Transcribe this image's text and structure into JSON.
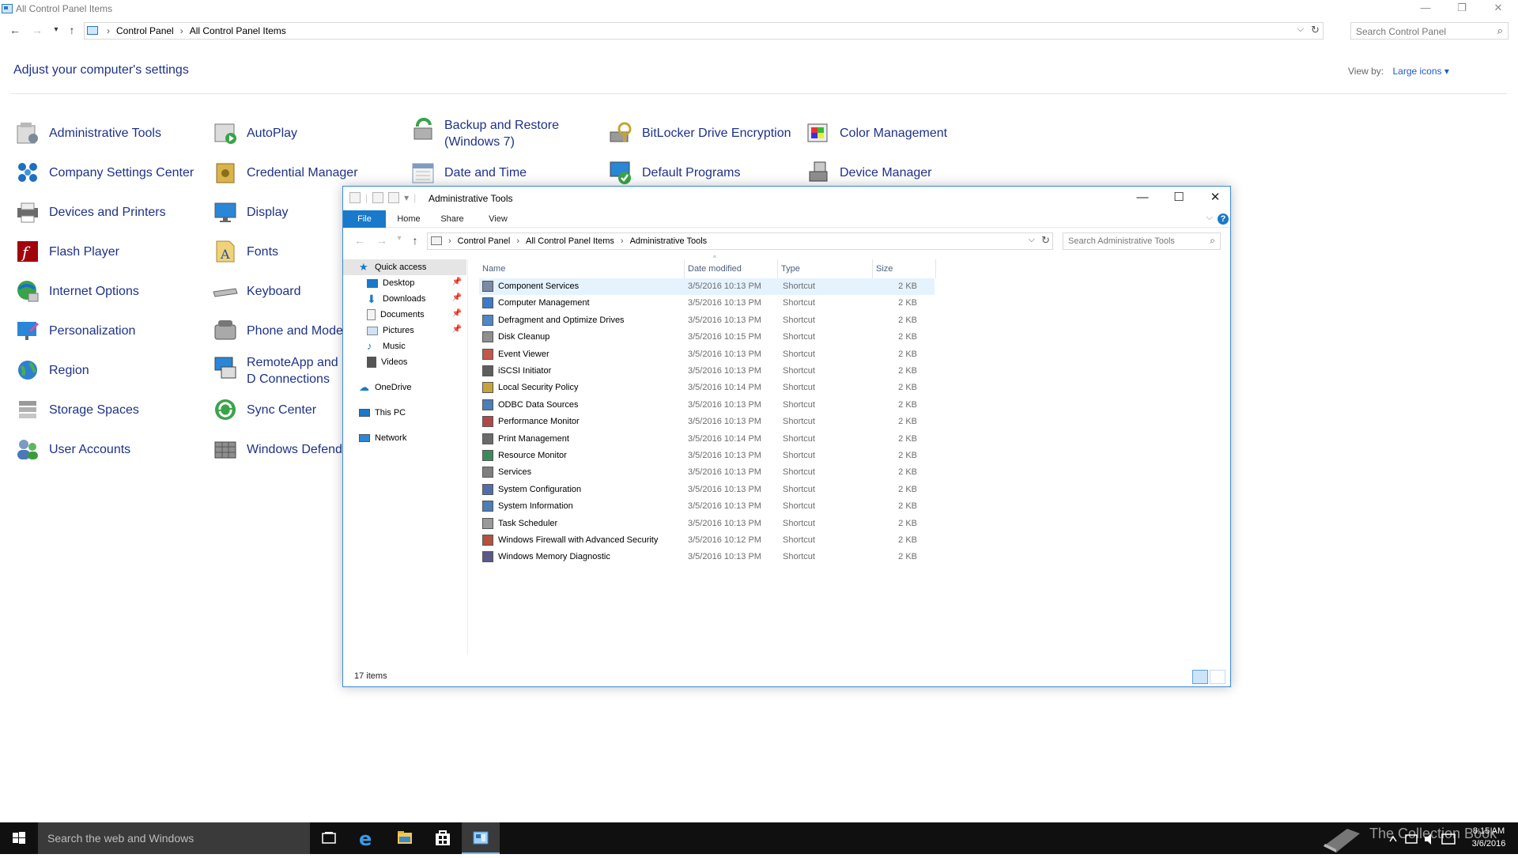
{
  "control_panel": {
    "window_title": "All Control Panel Items",
    "breadcrumb": [
      "Control Panel",
      "All Control Panel Items"
    ],
    "search_placeholder": "Search Control Panel",
    "heading": "Adjust your computer's settings",
    "view_by_label": "View by:",
    "view_by_value": "Large icons",
    "items": [
      {
        "label": "Administrative Tools",
        "icon": "admin-tools-icon"
      },
      {
        "label": "AutoPlay",
        "icon": "autoplay-icon"
      },
      {
        "label": "Backup and Restore (Windows 7)",
        "icon": "backup-icon"
      },
      {
        "label": "BitLocker Drive Encryption",
        "icon": "bitlocker-icon"
      },
      {
        "label": "Color Management",
        "icon": "color-management-icon"
      },
      {
        "label": "Company Settings Center",
        "icon": "company-settings-icon"
      },
      {
        "label": "Credential Manager",
        "icon": "credential-icon"
      },
      {
        "label": "Date and Time",
        "icon": "date-time-icon"
      },
      {
        "label": "Default Programs",
        "icon": "default-programs-icon"
      },
      {
        "label": "Device Manager",
        "icon": "device-manager-icon"
      },
      {
        "label": "Devices and Printers",
        "icon": "printer-icon"
      },
      {
        "label": "Display",
        "icon": "display-icon"
      },
      {
        "label": "Flash Player",
        "icon": "flash-icon"
      },
      {
        "label": "Fonts",
        "icon": "fonts-icon"
      },
      {
        "label": "Internet Options",
        "icon": "internet-icon"
      },
      {
        "label": "Keyboard",
        "icon": "keyboard-icon"
      },
      {
        "label": "Personalization",
        "icon": "personalization-icon"
      },
      {
        "label": "Phone and Moder",
        "icon": "phone-icon"
      },
      {
        "label": "Region",
        "icon": "globe-icon"
      },
      {
        "label": "RemoteApp and D Connections",
        "icon": "remoteapp-icon"
      },
      {
        "label": "Storage Spaces",
        "icon": "storage-icon"
      },
      {
        "label": "Sync Center",
        "icon": "sync-icon"
      },
      {
        "label": "User Accounts",
        "icon": "user-accounts-icon"
      },
      {
        "label": "Windows Defende",
        "icon": "defender-icon"
      }
    ]
  },
  "explorer": {
    "title": "Administrative Tools",
    "ribbon_tabs": [
      "File",
      "Home",
      "Share",
      "View"
    ],
    "breadcrumb": [
      "Control Panel",
      "All Control Panel Items",
      "Administrative Tools"
    ],
    "search_placeholder": "Search Administrative Tools",
    "nav": [
      {
        "label": "Quick access",
        "icon": "star-icon",
        "pinned": false
      },
      {
        "label": "Desktop",
        "icon": "desktop-icon",
        "pinned": true
      },
      {
        "label": "Downloads",
        "icon": "download-icon",
        "pinned": true
      },
      {
        "label": "Documents",
        "icon": "documents-icon",
        "pinned": true
      },
      {
        "label": "Pictures",
        "icon": "pictures-icon",
        "pinned": true
      },
      {
        "label": "Music",
        "icon": "music-icon",
        "pinned": false
      },
      {
        "label": "Videos",
        "icon": "videos-icon",
        "pinned": false
      },
      {
        "label": "OneDrive",
        "icon": "cloud-icon",
        "pinned": false
      },
      {
        "label": "This PC",
        "icon": "pc-icon",
        "pinned": false
      },
      {
        "label": "Network",
        "icon": "network-icon",
        "pinned": false
      }
    ],
    "columns": [
      "Name",
      "Date modified",
      "Type",
      "Size"
    ],
    "rows": [
      {
        "name": "Component Services",
        "date": "3/5/2016 10:13 PM",
        "type": "Shortcut",
        "size": "2 KB"
      },
      {
        "name": "Computer Management",
        "date": "3/5/2016 10:13 PM",
        "type": "Shortcut",
        "size": "2 KB"
      },
      {
        "name": "Defragment and Optimize Drives",
        "date": "3/5/2016 10:13 PM",
        "type": "Shortcut",
        "size": "2 KB"
      },
      {
        "name": "Disk Cleanup",
        "date": "3/5/2016 10:15 PM",
        "type": "Shortcut",
        "size": "2 KB"
      },
      {
        "name": "Event Viewer",
        "date": "3/5/2016 10:13 PM",
        "type": "Shortcut",
        "size": "2 KB"
      },
      {
        "name": "iSCSI Initiator",
        "date": "3/5/2016 10:13 PM",
        "type": "Shortcut",
        "size": "2 KB"
      },
      {
        "name": "Local Security Policy",
        "date": "3/5/2016 10:14 PM",
        "type": "Shortcut",
        "size": "2 KB"
      },
      {
        "name": "ODBC Data Sources",
        "date": "3/5/2016 10:13 PM",
        "type": "Shortcut",
        "size": "2 KB"
      },
      {
        "name": "Performance Monitor",
        "date": "3/5/2016 10:13 PM",
        "type": "Shortcut",
        "size": "2 KB"
      },
      {
        "name": "Print Management",
        "date": "3/5/2016 10:14 PM",
        "type": "Shortcut",
        "size": "2 KB"
      },
      {
        "name": "Resource Monitor",
        "date": "3/5/2016 10:13 PM",
        "type": "Shortcut",
        "size": "2 KB"
      },
      {
        "name": "Services",
        "date": "3/5/2016 10:13 PM",
        "type": "Shortcut",
        "size": "2 KB"
      },
      {
        "name": "System Configuration",
        "date": "3/5/2016 10:13 PM",
        "type": "Shortcut",
        "size": "2 KB"
      },
      {
        "name": "System Information",
        "date": "3/5/2016 10:13 PM",
        "type": "Shortcut",
        "size": "2 KB"
      },
      {
        "name": "Task Scheduler",
        "date": "3/5/2016 10:13 PM",
        "type": "Shortcut",
        "size": "2 KB"
      },
      {
        "name": "Windows Firewall with Advanced Security",
        "date": "3/5/2016 10:12 PM",
        "type": "Shortcut",
        "size": "2 KB"
      },
      {
        "name": "Windows Memory Diagnostic",
        "date": "3/5/2016 10:13 PM",
        "type": "Shortcut",
        "size": "2 KB"
      }
    ],
    "status_count": "17 items"
  },
  "taskbar": {
    "search_placeholder": "Search the web and Windows",
    "apps": [
      "task-view-icon",
      "edge-icon",
      "file-explorer-icon",
      "store-icon",
      "control-panel-icon"
    ],
    "watermark": "The Collection Book",
    "time": "8:15 AM",
    "date": "3/6/2016"
  },
  "colors": {
    "link_blue": "#1e3287",
    "accent_blue": "#1979ca",
    "selection": "#e5f3ff",
    "taskbar": "#101010"
  }
}
